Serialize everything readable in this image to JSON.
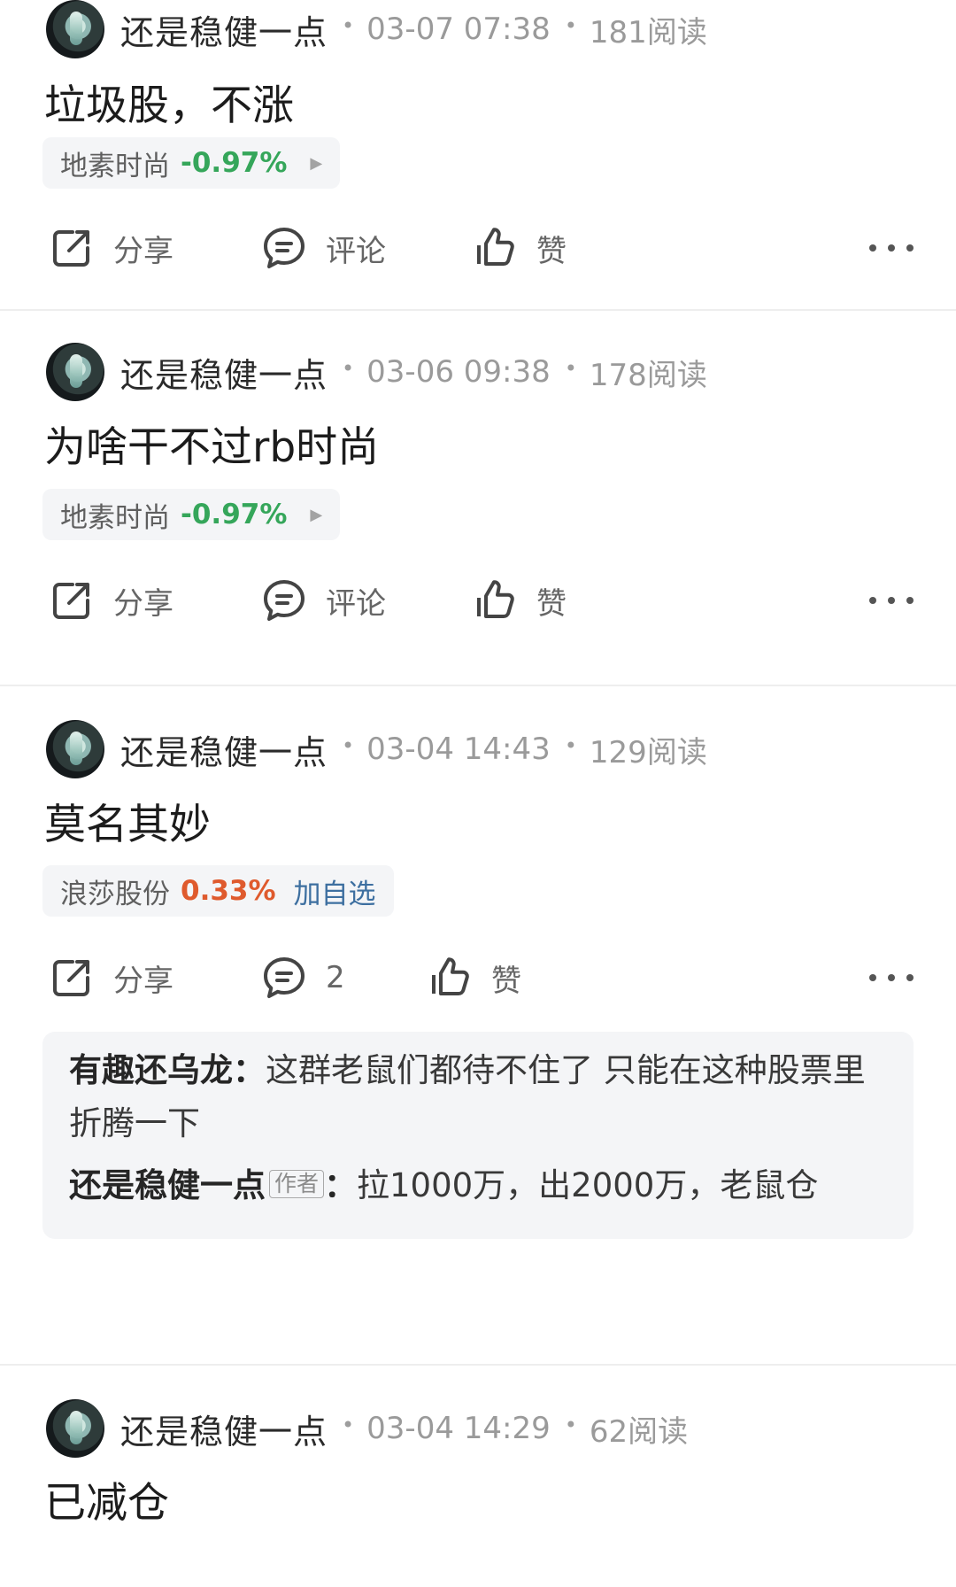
{
  "posts": [
    {
      "author": "还是稳健一点",
      "time": "03-07 07:38",
      "reads": "181阅读",
      "content": "垃圾股，不涨",
      "stock": {
        "name": "地素时尚",
        "change": "-0.97%",
        "change_color": "#35a65a"
      },
      "actions": {
        "share": "分享",
        "comment": "评论",
        "like": "赞"
      }
    },
    {
      "author": "还是稳健一点",
      "time": "03-06 09:38",
      "reads": "178阅读",
      "content": "为啥干不过rb时尚",
      "stock": {
        "name": "地素时尚",
        "change": "-0.97%",
        "change_color": "#35a65a"
      },
      "actions": {
        "share": "分享",
        "comment": "评论",
        "like": "赞"
      }
    },
    {
      "author": "还是稳健一点",
      "time": "03-04 14:43",
      "reads": "129阅读",
      "content": "莫名其妙",
      "stock": {
        "name": "浪莎股份",
        "change": "0.33%",
        "change_color": "#df5a2d",
        "action": "加自选"
      },
      "actions": {
        "share": "分享",
        "comment": "2",
        "like": "赞"
      },
      "comments": [
        {
          "user": "有趣还乌龙：",
          "text": "这群老鼠们都待不住了 只能在这种股票里折腾一下"
        },
        {
          "user": "还是稳健一点",
          "badge": "作者",
          "separator": "：",
          "text": "拉1000万，出2000万，老鼠仓"
        }
      ]
    },
    {
      "author": "还是稳健一点",
      "time": "03-04 14:29",
      "reads": "62阅读",
      "content": "已减仓"
    }
  ],
  "icons": {
    "share": "share-icon",
    "comment": "comment-icon",
    "like": "like-icon",
    "more": "more-icon"
  }
}
